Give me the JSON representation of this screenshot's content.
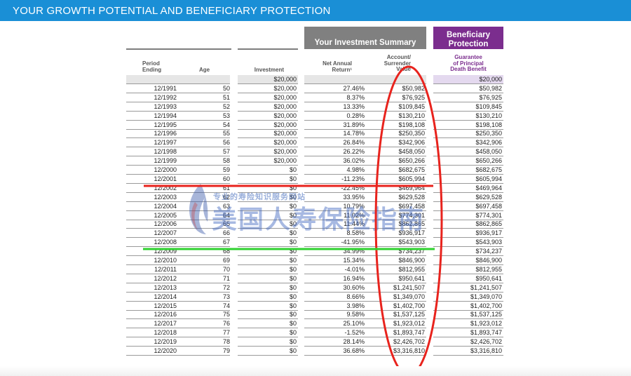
{
  "header": {
    "title": "YOUR GROWTH POTENTIAL AND BENEFICIARY PROTECTION"
  },
  "summary": {
    "label": "Your Investment Summary"
  },
  "beneficiary": {
    "label_line1": "Beneficiary",
    "label_line2": "Protection"
  },
  "columns": {
    "period_line1": "Period",
    "period_line2": "Ending",
    "age": "Age",
    "investment": "Investment",
    "return_line1": "Net Annual",
    "return_line2": "Return¹",
    "account_line1": "Account/",
    "account_line2": "Surrender",
    "account_line3": "Value",
    "guarantee_line1": "Guarantee",
    "guarantee_line2": "of Principal",
    "guarantee_line3": "Death Benefit"
  },
  "initial": {
    "investment": "$20,000",
    "guarantee": "$20,000"
  },
  "rows": [
    {
      "period": "12/1991",
      "age": "50",
      "investment": "$20,000",
      "return": "27.46%",
      "value": "$50,982",
      "guarantee": "$50,982"
    },
    {
      "period": "12/1992",
      "age": "51",
      "investment": "$20,000",
      "return": "8.37%",
      "value": "$76,925",
      "guarantee": "$76,925"
    },
    {
      "period": "12/1993",
      "age": "52",
      "investment": "$20,000",
      "return": "13.33%",
      "value": "$109,845",
      "guarantee": "$109,845"
    },
    {
      "period": "12/1994",
      "age": "53",
      "investment": "$20,000",
      "return": "0.28%",
      "value": "$130,210",
      "guarantee": "$130,210"
    },
    {
      "period": "12/1995",
      "age": "54",
      "investment": "$20,000",
      "return": "31.89%",
      "value": "$198,108",
      "guarantee": "$198,108"
    },
    {
      "period": "12/1996",
      "age": "55",
      "investment": "$20,000",
      "return": "14.78%",
      "value": "$250,350",
      "guarantee": "$250,350"
    },
    {
      "period": "12/1997",
      "age": "56",
      "investment": "$20,000",
      "return": "26.84%",
      "value": "$342,906",
      "guarantee": "$342,906"
    },
    {
      "period": "12/1998",
      "age": "57",
      "investment": "$20,000",
      "return": "26.22%",
      "value": "$458,050",
      "guarantee": "$458,050"
    },
    {
      "period": "12/1999",
      "age": "58",
      "investment": "$20,000",
      "return": "36.02%",
      "value": "$650,266",
      "guarantee": "$650,266"
    },
    {
      "period": "12/2000",
      "age": "59",
      "investment": "$0",
      "return": "4.98%",
      "value": "$682,675",
      "guarantee": "$682,675"
    },
    {
      "period": "12/2001",
      "age": "60",
      "investment": "$0",
      "return": "-11.23%",
      "value": "$605,994",
      "guarantee": "$605,994"
    },
    {
      "period": "12/2002",
      "age": "61",
      "investment": "$0",
      "return": "-22.45%",
      "value": "$469,964",
      "guarantee": "$469,964"
    },
    {
      "period": "12/2003",
      "age": "62",
      "investment": "$0",
      "return": "33.95%",
      "value": "$629,528",
      "guarantee": "$629,528"
    },
    {
      "period": "12/2004",
      "age": "63",
      "investment": "$0",
      "return": "10.79%",
      "value": "$697,458",
      "guarantee": "$697,458"
    },
    {
      "period": "12/2005",
      "age": "64",
      "investment": "$0",
      "return": "11.02%",
      "value": "$774,301",
      "guarantee": "$774,301"
    },
    {
      "period": "12/2006",
      "age": "65",
      "investment": "$0",
      "return": "11.44%",
      "value": "$862,865",
      "guarantee": "$862,865"
    },
    {
      "period": "12/2007",
      "age": "66",
      "investment": "$0",
      "return": "8.58%",
      "value": "$936,917",
      "guarantee": "$936,917"
    },
    {
      "period": "12/2008",
      "age": "67",
      "investment": "$0",
      "return": "-41.95%",
      "value": "$543,903",
      "guarantee": "$543,903"
    },
    {
      "period": "12/2009",
      "age": "68",
      "investment": "$0",
      "return": "34.99%",
      "value": "$734,237",
      "guarantee": "$734,237"
    },
    {
      "period": "12/2010",
      "age": "69",
      "investment": "$0",
      "return": "15.34%",
      "value": "$846,900",
      "guarantee": "$846,900"
    },
    {
      "period": "12/2011",
      "age": "70",
      "investment": "$0",
      "return": "-4.01%",
      "value": "$812,955",
      "guarantee": "$812,955"
    },
    {
      "period": "12/2012",
      "age": "71",
      "investment": "$0",
      "return": "16.94%",
      "value": "$950,641",
      "guarantee": "$950,641"
    },
    {
      "period": "12/2013",
      "age": "72",
      "investment": "$0",
      "return": "30.60%",
      "value": "$1,241,507",
      "guarantee": "$1,241,507"
    },
    {
      "period": "12/2014",
      "age": "73",
      "investment": "$0",
      "return": "8.66%",
      "value": "$1,349,070",
      "guarantee": "$1,349,070"
    },
    {
      "period": "12/2015",
      "age": "74",
      "investment": "$0",
      "return": "3.98%",
      "value": "$1,402,700",
      "guarantee": "$1,402,700"
    },
    {
      "period": "12/2016",
      "age": "75",
      "investment": "$0",
      "return": "9.58%",
      "value": "$1,537,125",
      "guarantee": "$1,537,125"
    },
    {
      "period": "12/2017",
      "age": "76",
      "investment": "$0",
      "return": "25.10%",
      "value": "$1,923,012",
      "guarantee": "$1,923,012"
    },
    {
      "period": "12/2018",
      "age": "77",
      "investment": "$0",
      "return": "-1.52%",
      "value": "$1,893,747",
      "guarantee": "$1,893,747"
    },
    {
      "period": "12/2019",
      "age": "78",
      "investment": "$0",
      "return": "28.14%",
      "value": "$2,426,702",
      "guarantee": "$2,426,702"
    },
    {
      "period": "12/2020",
      "age": "79",
      "investment": "$0",
      "return": "36.68%",
      "value": "$3,316,810",
      "guarantee": "$3,316,810"
    }
  ],
  "watermark": {
    "small": "专业的寿险知识服务网站",
    "big": "美国人寿保险指南"
  },
  "annotations": {
    "circle_color": "#e8231d",
    "red_line_color": "#e8231d",
    "green_line_color": "#2fd12f"
  },
  "colors": {
    "banner": "#1a8fd6",
    "summary": "#808080",
    "beneficiary": "#7b2d8e"
  }
}
